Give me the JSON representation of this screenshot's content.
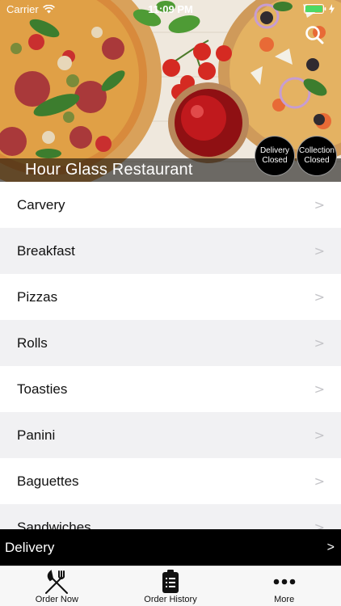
{
  "status_bar": {
    "carrier": "Carrier",
    "time": "11:09 PM"
  },
  "header": {
    "restaurant_name": "Hour Glass Restaurant",
    "delivery_badge": [
      "Delivery",
      "Closed"
    ],
    "collection_badge": [
      "Collection",
      "Closed"
    ]
  },
  "menu": {
    "items": [
      {
        "label": "Carvery"
      },
      {
        "label": "Breakfast"
      },
      {
        "label": "Pizzas"
      },
      {
        "label": "Rolls"
      },
      {
        "label": "Toasties"
      },
      {
        "label": "Panini"
      },
      {
        "label": "Baguettes"
      },
      {
        "label": "Sandwiches"
      }
    ],
    "chevron": ">"
  },
  "delivery_bar": {
    "label": "Delivery",
    "arrow": ">"
  },
  "tab_bar": {
    "tabs": [
      {
        "label": "Order Now",
        "icon": "fork-knife-icon"
      },
      {
        "label": "Order History",
        "icon": "clipboard-icon"
      },
      {
        "label": "More",
        "icon": "more-dots-icon"
      }
    ]
  },
  "colors": {
    "battery": "#4cd964",
    "bar_background": "#000000",
    "alt_row": "#f1f1f3"
  }
}
